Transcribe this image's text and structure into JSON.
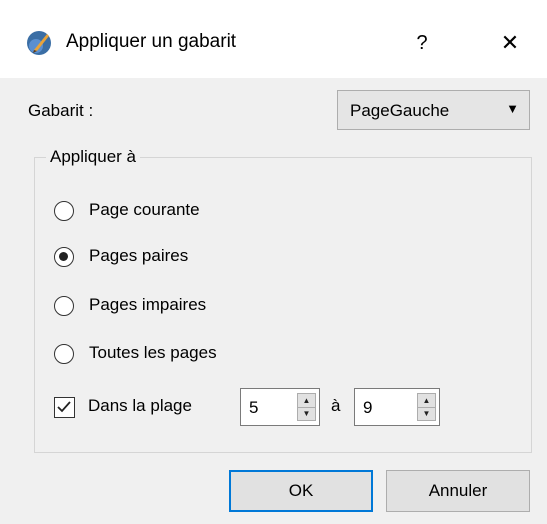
{
  "dialog": {
    "title": "Appliquer un gabarit",
    "help_label": "?",
    "close_label": "✕"
  },
  "template": {
    "label": "Gabarit :",
    "selected": "PageGauche",
    "arrow": "▼"
  },
  "apply_to": {
    "title": "Appliquer à",
    "options": [
      {
        "label": "Page courante",
        "checked": false
      },
      {
        "label": "Pages paires",
        "checked": true
      },
      {
        "label": "Pages impaires",
        "checked": false
      },
      {
        "label": "Toutes les pages",
        "checked": false
      }
    ],
    "range": {
      "checked": true,
      "label": "Dans la plage",
      "from": "5",
      "to_label": "à",
      "to": "9"
    }
  },
  "buttons": {
    "ok": "OK",
    "cancel": "Annuler"
  },
  "colors": {
    "accent": "#0078d7",
    "background": "#f0f0f0"
  }
}
